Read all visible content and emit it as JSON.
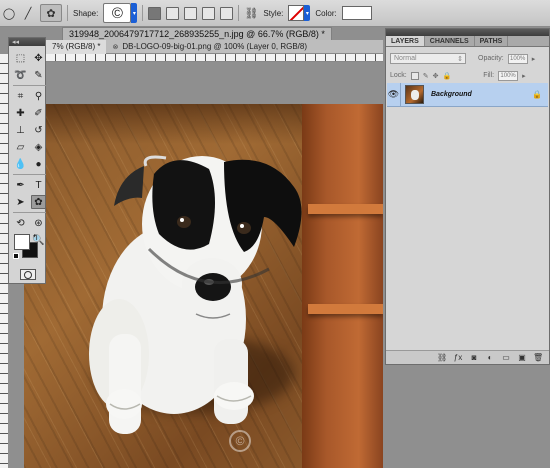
{
  "options_bar": {
    "shape_label": "Shape:",
    "shape_value": "©",
    "style_label": "Style:",
    "color_label": "Color:",
    "color_value": "#ffffff"
  },
  "document": {
    "title": "319948_2006479717712_268935255_n.jpg @ 66.7% (RGB/8) *",
    "tabs": [
      {
        "label": "7% (RGB/8) *"
      },
      {
        "label": "DB-LOGO-09-big-01.png @ 100% (Layer 0, RGB/8)"
      }
    ]
  },
  "photo": {
    "watermark": "©"
  },
  "tools": {
    "items": [
      {
        "name": "marquee-tool",
        "glyph": "⬚"
      },
      {
        "name": "move-tool",
        "glyph": "✥"
      },
      {
        "name": "lasso-tool",
        "glyph": "➰"
      },
      {
        "name": "quick-select-tool",
        "glyph": "✎"
      },
      {
        "name": "crop-tool",
        "glyph": "⌗"
      },
      {
        "name": "eyedropper-tool",
        "glyph": "⚲"
      },
      {
        "name": "healing-tool",
        "glyph": "✚"
      },
      {
        "name": "brush-tool",
        "glyph": "✐"
      },
      {
        "name": "stamp-tool",
        "glyph": "⊥"
      },
      {
        "name": "history-brush-tool",
        "glyph": "↺"
      },
      {
        "name": "eraser-tool",
        "glyph": "▱"
      },
      {
        "name": "paint-bucket-tool",
        "glyph": "◈"
      },
      {
        "name": "blur-tool",
        "glyph": "💧"
      },
      {
        "name": "dodge-tool",
        "glyph": "●"
      },
      {
        "name": "pen-tool",
        "glyph": "✒"
      },
      {
        "name": "type-tool",
        "glyph": "T"
      },
      {
        "name": "path-select-tool",
        "glyph": "➤"
      },
      {
        "name": "custom-shape-tool",
        "glyph": "✿"
      },
      {
        "name": "3d-rotate-tool",
        "glyph": "⟲"
      },
      {
        "name": "3d-orbit-tool",
        "glyph": "⊛"
      },
      {
        "name": "hand-tool",
        "glyph": "✋"
      },
      {
        "name": "zoom-tool",
        "glyph": "🔍"
      }
    ]
  },
  "layers_panel": {
    "tabs": [
      "LAYERS",
      "CHANNELS",
      "PATHS"
    ],
    "blend_mode": "Normal",
    "opacity_label": "Opacity:",
    "opacity_value": "100%",
    "lock_label": "Lock:",
    "fill_label": "Fill:",
    "fill_value": "100%",
    "layers": [
      {
        "name": "Background",
        "locked": true
      }
    ],
    "footer_icons": [
      "link-icon",
      "fx-icon",
      "mask-icon",
      "adjustment-icon",
      "group-icon",
      "new-layer-icon",
      "trash-icon"
    ]
  }
}
